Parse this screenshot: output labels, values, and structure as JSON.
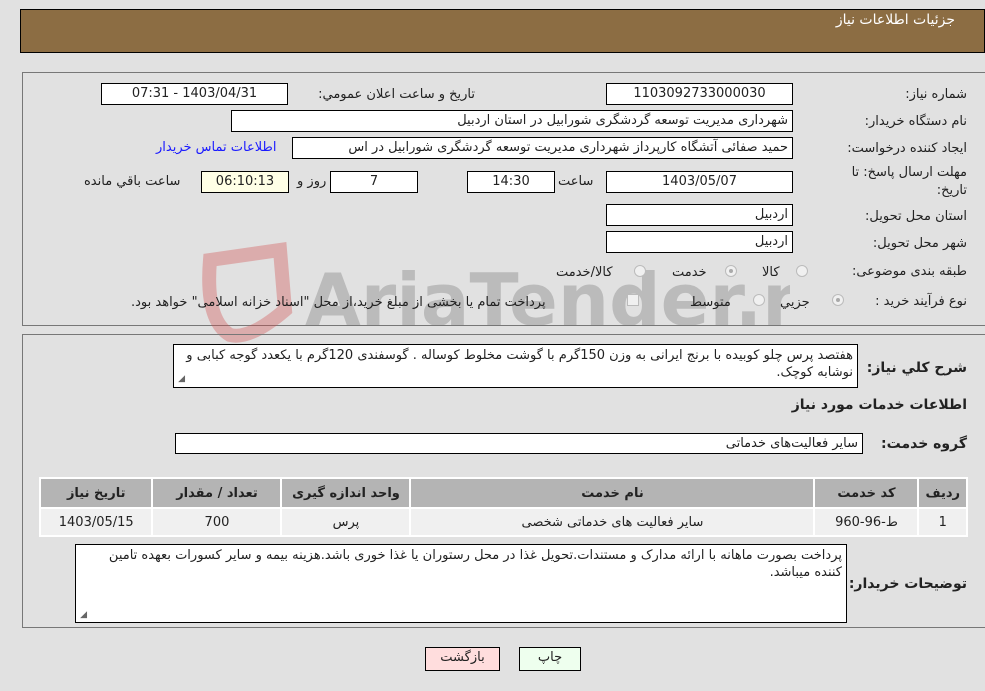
{
  "header": {
    "title": "جزئیات اطلاعات نیاز"
  },
  "form": {
    "need_number": {
      "label": "شماره نیاز:",
      "value": "1103092733000030"
    },
    "announce_datetime": {
      "label": "تاریخ و ساعت اعلان عمومي:",
      "value": "1403/04/31 - 07:31"
    },
    "buyer_org": {
      "label": "نام دستگاه خريدار:",
      "value": "شهرداری مدیریت توسعه گردشگری شورابیل در استان اردبیل"
    },
    "requester": {
      "label": "ایجاد کننده درخواست:",
      "value": "حمید صفائی آتشگاه کارپرداز شهرداری مدیریت توسعه گردشگری شورابیل در اس",
      "contact_link": "اطلاعات تماس خریدار"
    },
    "deadline": {
      "label_line1": "مهلت ارسال پاسخ: تا",
      "label_line2": "تاریخ:",
      "date": "1403/05/07",
      "time_label": "ساعت",
      "time": "14:30",
      "days": "7",
      "days_label": "روز و",
      "remaining": "06:10:13",
      "remaining_label": "ساعت باقي مانده"
    },
    "delivery_province": {
      "label": "استان محل تحویل:",
      "value": "اردبیل"
    },
    "delivery_city": {
      "label": "شهر محل تحویل:",
      "value": "اردبیل"
    },
    "category": {
      "label": "طبقه بندی موضوعی:",
      "options": [
        "کالا",
        "خدمت",
        "کالا/خدمت"
      ],
      "selected": "خدمت"
    },
    "purchase_type": {
      "label": "نوع فرآیند خرید :",
      "options": [
        "جزيي",
        "متوسط"
      ],
      "selected": "جزيي",
      "treasury_note": "پرداخت تمام یا بخشی از مبلغ خرید،از محل \"اسناد خزانه اسلامی\" خواهد بود."
    }
  },
  "description": {
    "label": "شرح کلي نياز:",
    "value": "هفتصد پرس چلو کوبیده با برنج ایرانی به وزن 150گرم با گوشت مخلوط کوساله . گوسفندی 120گرم با یکعدد گوجه کبابی و نوشابه کوچک."
  },
  "services": {
    "section_title": "اطلاعات خدمات مورد نياز",
    "group_label": "گروه خدمت:",
    "group_value": "سایر فعالیت‌های خدماتی",
    "table": {
      "headers": [
        "رديف",
        "کد خدمت",
        "نام خدمت",
        "واحد اندازه گيری",
        "تعداد / مقدار",
        "تاريخ نياز"
      ],
      "rows": [
        [
          "1",
          "ط-96-960",
          "سایر فعالیت های خدماتی شخصی",
          "پرس",
          "700",
          "1403/05/15"
        ]
      ]
    }
  },
  "buyer_notes": {
    "label": "توضيحات خريدار:",
    "value": "پرداخت بصورت ماهانه با ارائه مدارک و مستندات.تحویل غذا در محل رستوران یا غذا خوری باشد.هزینه بیمه و سایر کسورات بعهده تامین کننده میباشد."
  },
  "buttons": {
    "print": "چاپ",
    "back": "بازگشت"
  },
  "colors": {
    "header_bg": "#8c6d43",
    "print_bg": "#eeffee",
    "back_bg": "#ffdddd",
    "link": "#1a1aff"
  },
  "watermark": {
    "text": "AriaTender.neT"
  }
}
